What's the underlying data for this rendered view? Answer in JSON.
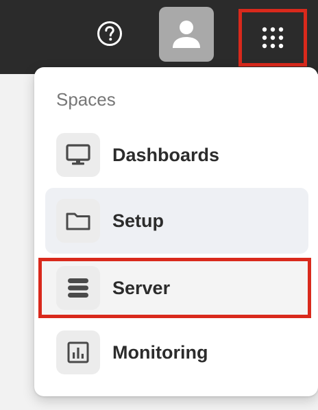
{
  "topbar": {
    "help_icon": "help-circle-icon",
    "avatar_icon": "user-icon",
    "apps_icon": "apps-grid-icon"
  },
  "spaces_menu": {
    "section_label": "Spaces",
    "items": [
      {
        "label": "Dashboards",
        "icon": "monitor-icon"
      },
      {
        "label": "Setup",
        "icon": "folder-icon"
      },
      {
        "label": "Server",
        "icon": "server-icon"
      },
      {
        "label": "Monitoring",
        "icon": "bar-chart-icon"
      }
    ]
  },
  "colors": {
    "topbar": "#2b2b2b",
    "highlight_outline": "#d9291c",
    "menu_background": "#ffffff",
    "active_item_background": "#eef0f4"
  }
}
